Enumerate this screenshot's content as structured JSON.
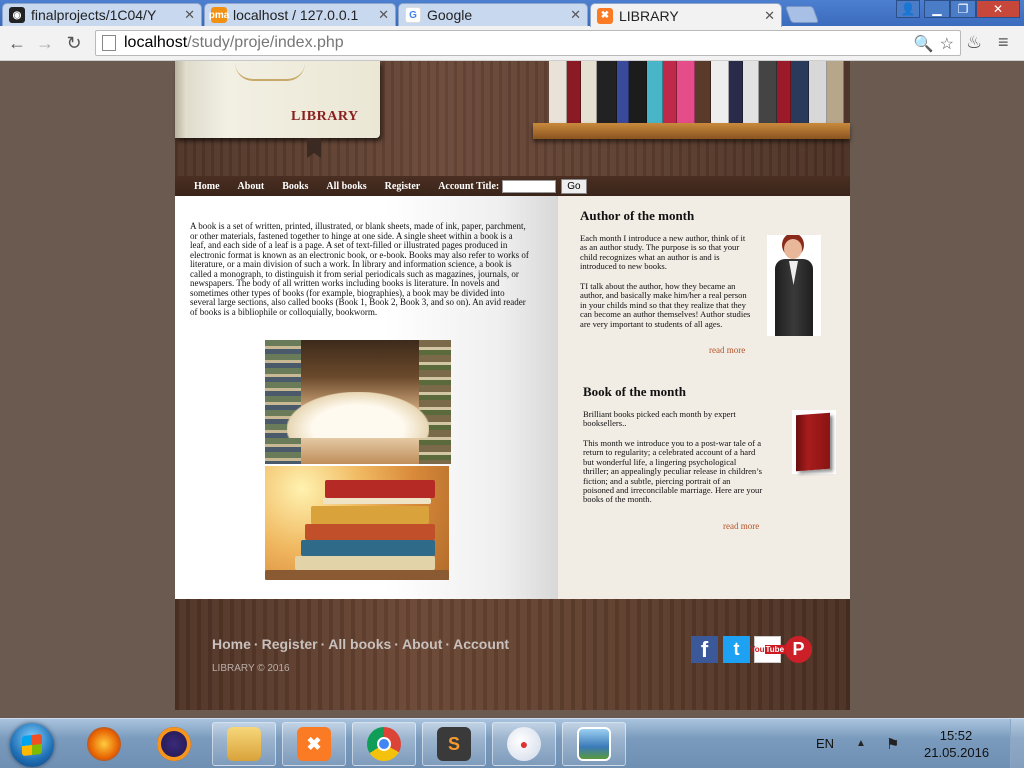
{
  "browser": {
    "tabs": [
      {
        "title": "finalprojects/1C04/Y",
        "favicon": "github-icon"
      },
      {
        "title": "localhost / 127.0.0.1",
        "favicon": "phpmyadmin-icon"
      },
      {
        "title": "Google",
        "favicon": "google-icon"
      },
      {
        "title": "LIBRARY",
        "favicon": "xampp-icon"
      }
    ],
    "url_host": "localhost",
    "url_path": "/study/proje/index.php"
  },
  "site": {
    "header_title": "LIBRARY",
    "nav": {
      "items": [
        "Home",
        "About",
        "Books",
        "All books",
        "Register"
      ],
      "account_label": "Account Title:",
      "account_value": "",
      "go_label": "Go"
    },
    "intro": "A book is a set of written, printed, illustrated, or blank sheets, made of ink, paper, parchment, or other materials, fastened together to hinge at one side. A single sheet within a book is a leaf, and each side of a leaf is a page. A set of text-filled or illustrated pages produced in electronic format is known as an electronic book, or e-book. Books may also refer to works of literature, or a main division of such a work. In library and information science, a book is called a monograph, to distinguish it from serial periodicals such as magazines, journals, or newspapers. The body of all written works including books is literature. In novels and sometimes other types of books (for example, biographies), a book may be divided into several large sections, also called books (Book 1, Book 2, Book 3, and so on). An avid reader of books is a bibliophile or colloquially, bookworm.",
    "author": {
      "heading": "Author of the month",
      "para1": "Each month I introduce a new author, think of it as an author study. The purpose is so that your child recognizes what an author is and is introduced to new books.",
      "para2": "TI talk about the author, how they became an author, and basically make him/her a real person in your childs mind so that they realize that they can become an author themselves! Author studies are very important to students of all ages.",
      "more": "read more"
    },
    "book": {
      "heading": "Book of the month",
      "para1": "Brilliant books picked each month by expert booksellers..",
      "para2": "This month we introduce you to a post-war tale of a return to regularity; a celebrated account of a hard but wonderful life, a lingering psychological thriller; an appealingly peculiar release in children’s fiction; and a subtle, piercing portrait of an poisoned and irreconcilable marriage. Here are your books of the month.",
      "more": "read more"
    },
    "footer": {
      "links": [
        "Home",
        "Register",
        "All books",
        "About",
        "Account"
      ],
      "separator": "·",
      "copyright": "LIBRARY © 2016",
      "social": [
        {
          "name": "facebook-icon",
          "glyph": "f",
          "color": "#3b5998"
        },
        {
          "name": "twitter-icon",
          "glyph": "t",
          "color": "#1da1f2"
        },
        {
          "name": "youtube-icon",
          "glyph": "You",
          "color": "#cc181e"
        },
        {
          "name": "pinterest-icon",
          "glyph": "P",
          "color": "#cb2027"
        }
      ]
    }
  },
  "taskbar": {
    "language": "EN",
    "time": "15:52",
    "date": "21.05.2016"
  }
}
